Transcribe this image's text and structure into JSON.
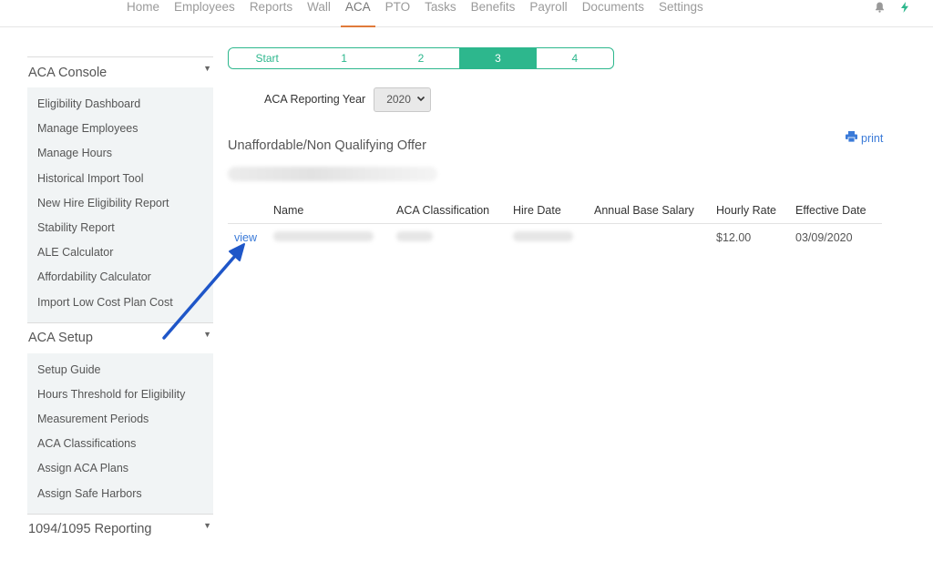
{
  "nav": {
    "items": [
      "Home",
      "Employees",
      "Reports",
      "Wall",
      "ACA",
      "PTO",
      "Tasks",
      "Benefits",
      "Payroll",
      "Documents",
      "Settings"
    ],
    "active": "ACA"
  },
  "icons": {
    "bell": "bell-icon",
    "bolt": "bolt-icon",
    "print": "printer-icon",
    "caret": "caret-down-icon"
  },
  "colors": {
    "accent": "#2db78d",
    "link": "#3a7ad8",
    "nav_active_underline": "#e07a3a",
    "annotation_arrow": "#1f56c8"
  },
  "sidebar": {
    "sections": [
      {
        "title": "ACA Console",
        "items": [
          "Eligibility Dashboard",
          "Manage Employees",
          "Manage Hours",
          "Historical Import Tool",
          "New Hire Eligibility Report",
          "Stability Report",
          "ALE Calculator",
          "Affordability Calculator",
          "Import Low Cost Plan Cost"
        ]
      },
      {
        "title": "ACA Setup",
        "items": [
          "Setup Guide",
          "Hours Threshold for Eligibility",
          "Measurement Periods",
          "ACA Classifications",
          "Assign ACA Plans",
          "Assign Safe Harbors"
        ]
      },
      {
        "title": "1094/1095 Reporting",
        "items": []
      }
    ]
  },
  "stepper": {
    "steps": [
      "Start",
      "1",
      "2",
      "3",
      "4"
    ],
    "active": "3"
  },
  "reporting_year": {
    "label": "ACA Reporting Year",
    "value": "2020"
  },
  "report": {
    "title": "Unaffordable/Non Qualifying Offer",
    "print_label": "print",
    "columns": [
      "",
      "Name",
      "ACA Classification",
      "Hire Date",
      "Annual Base Salary",
      "Hourly Rate",
      "Effective Date"
    ],
    "rows": [
      {
        "action": "view",
        "hourly_rate": "$12.00",
        "effective_date": "03/09/2020"
      }
    ]
  }
}
